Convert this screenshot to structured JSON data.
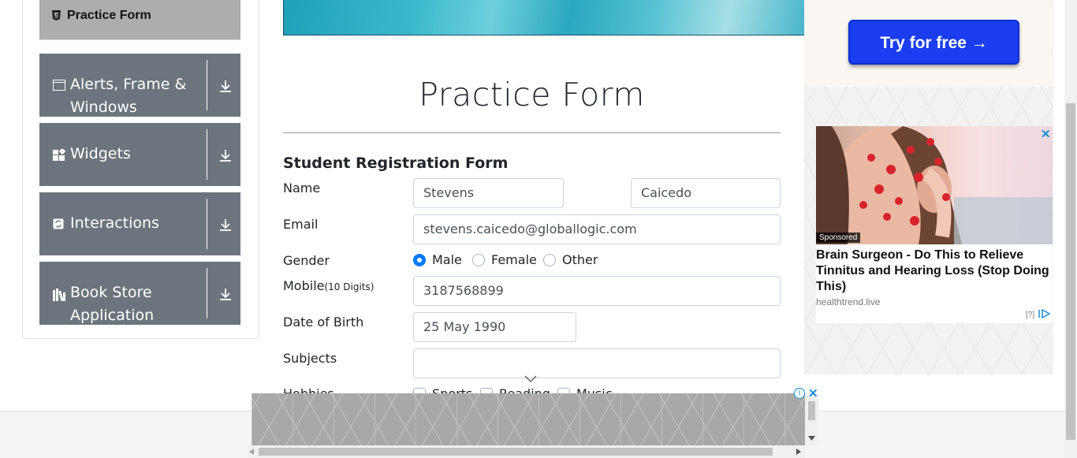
{
  "sidebar": {
    "active_item": {
      "label": "Practice Form",
      "icon": "html5-icon"
    },
    "groups": [
      {
        "label": "Alerts, Frame & Windows",
        "icon": "window-icon"
      },
      {
        "label": "Widgets",
        "icon": "widgets-icon"
      },
      {
        "label": "Interactions",
        "icon": "interactions-icon"
      },
      {
        "label": "Book Store Application",
        "icon": "books-icon"
      }
    ]
  },
  "main": {
    "title": "Practice Form",
    "form_heading": "Student Registration Form",
    "labels": {
      "name": "Name",
      "email": "Email",
      "gender": "Gender",
      "mobile": "Mobile",
      "mobile_hint": "(10 Digits)",
      "dob": "Date of Birth",
      "subjects": "Subjects",
      "hobbies": "Hobbies"
    },
    "fields": {
      "first_name": "Stevens",
      "last_name": "Caicedo",
      "email": "stevens.caicedo@globallogic.com",
      "mobile": "3187568899",
      "dob": "25 May 1990",
      "subjects": ""
    },
    "gender_options": [
      "Male",
      "Female",
      "Other"
    ],
    "gender_selected": "Male",
    "hobby_options": [
      "Sports",
      "Reading",
      "Music"
    ]
  },
  "right_ad": {
    "button_label": "Try for free →",
    "sponsored": "Sponsored",
    "headline": "Brain Surgeon - Do This to Relieve Tinnitus and Hearing Loss (Stop Doing This)",
    "source": "healthtrend.live",
    "adchoices": "[?]"
  },
  "colors": {
    "sidebar_group": "#6c757d",
    "sidebar_active": "#adadad",
    "radio_checked": "#007bff",
    "ad_button": "#1a3df0"
  }
}
